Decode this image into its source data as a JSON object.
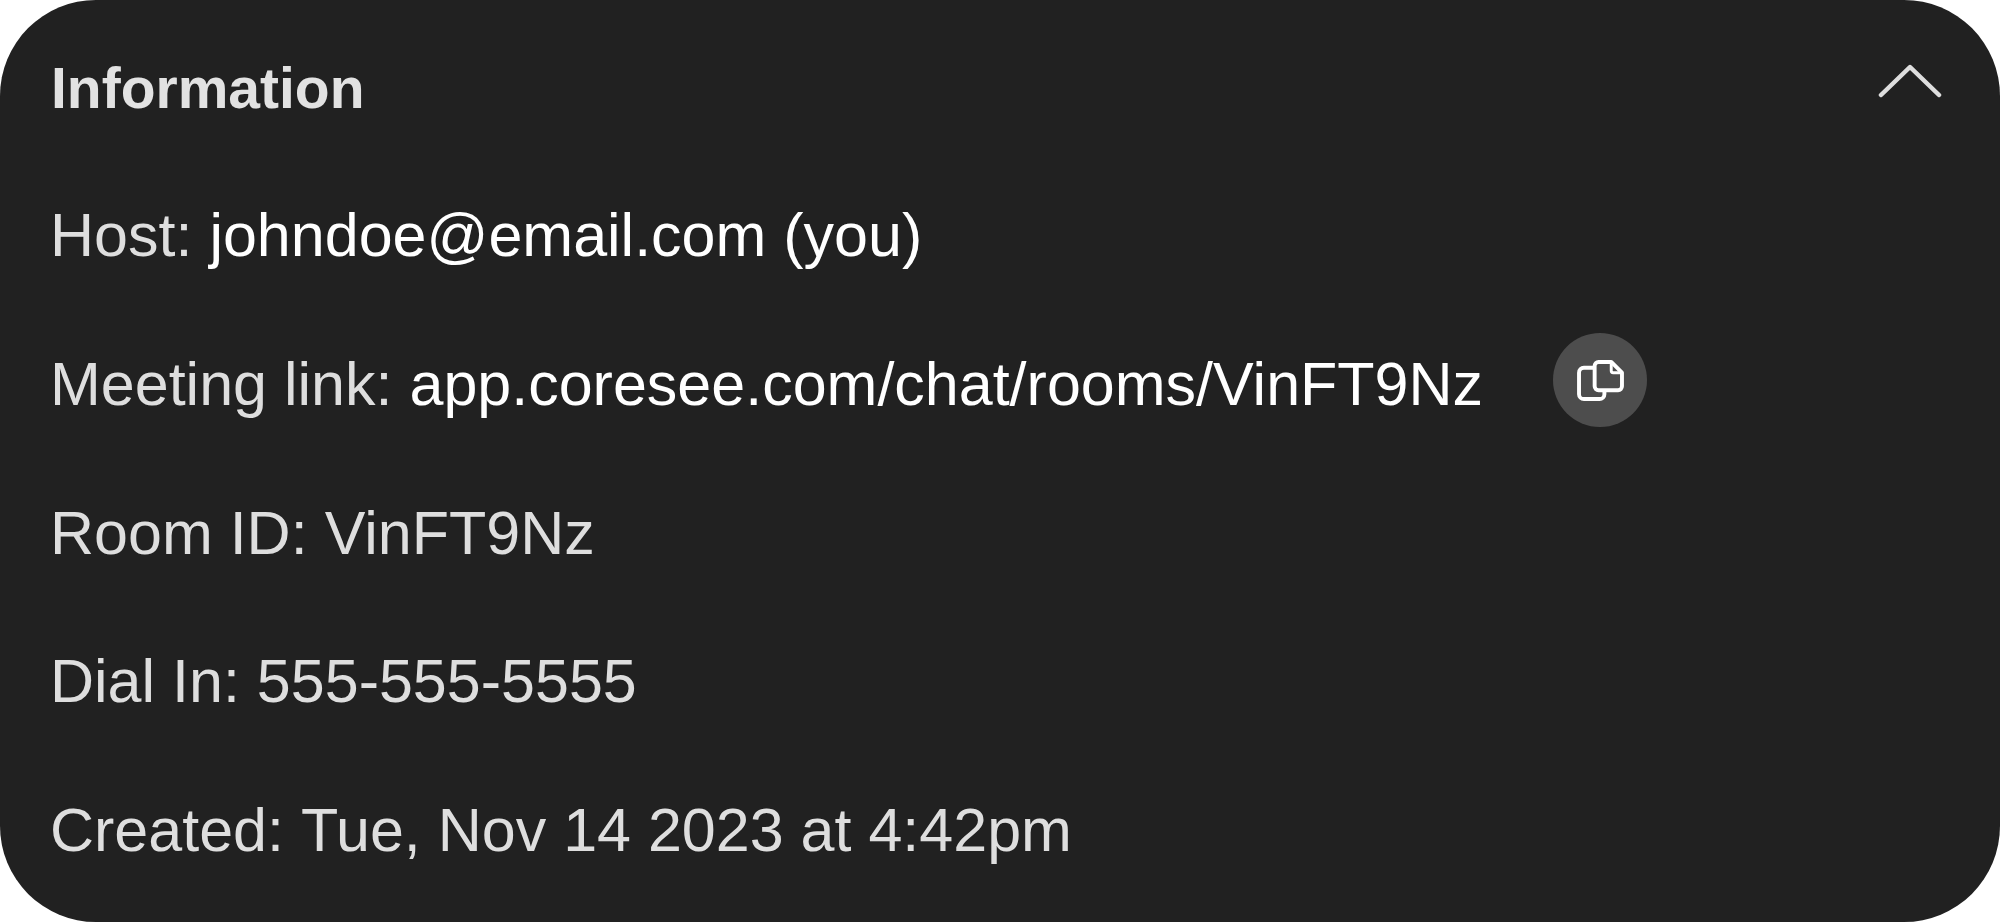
{
  "panel": {
    "title": "Information",
    "expanded": true
  },
  "rows": [
    {
      "label": "Host:",
      "value": "johndoe@email.com (you)",
      "kind": "link",
      "copyable": false
    },
    {
      "label": "Meeting link:",
      "value": "app.coresee.com/chat/rooms/VinFT9Nz",
      "kind": "link",
      "copyable": true
    },
    {
      "label": "Room ID:",
      "value": "VinFT9Nz",
      "kind": "text",
      "copyable": false
    },
    {
      "label": "Dial In:",
      "value": "555-555-5555",
      "kind": "text",
      "copyable": false
    },
    {
      "label": "Created:",
      "value": "Tue, Nov 14 2023 at 4:42pm",
      "kind": "text",
      "copyable": false
    }
  ]
}
